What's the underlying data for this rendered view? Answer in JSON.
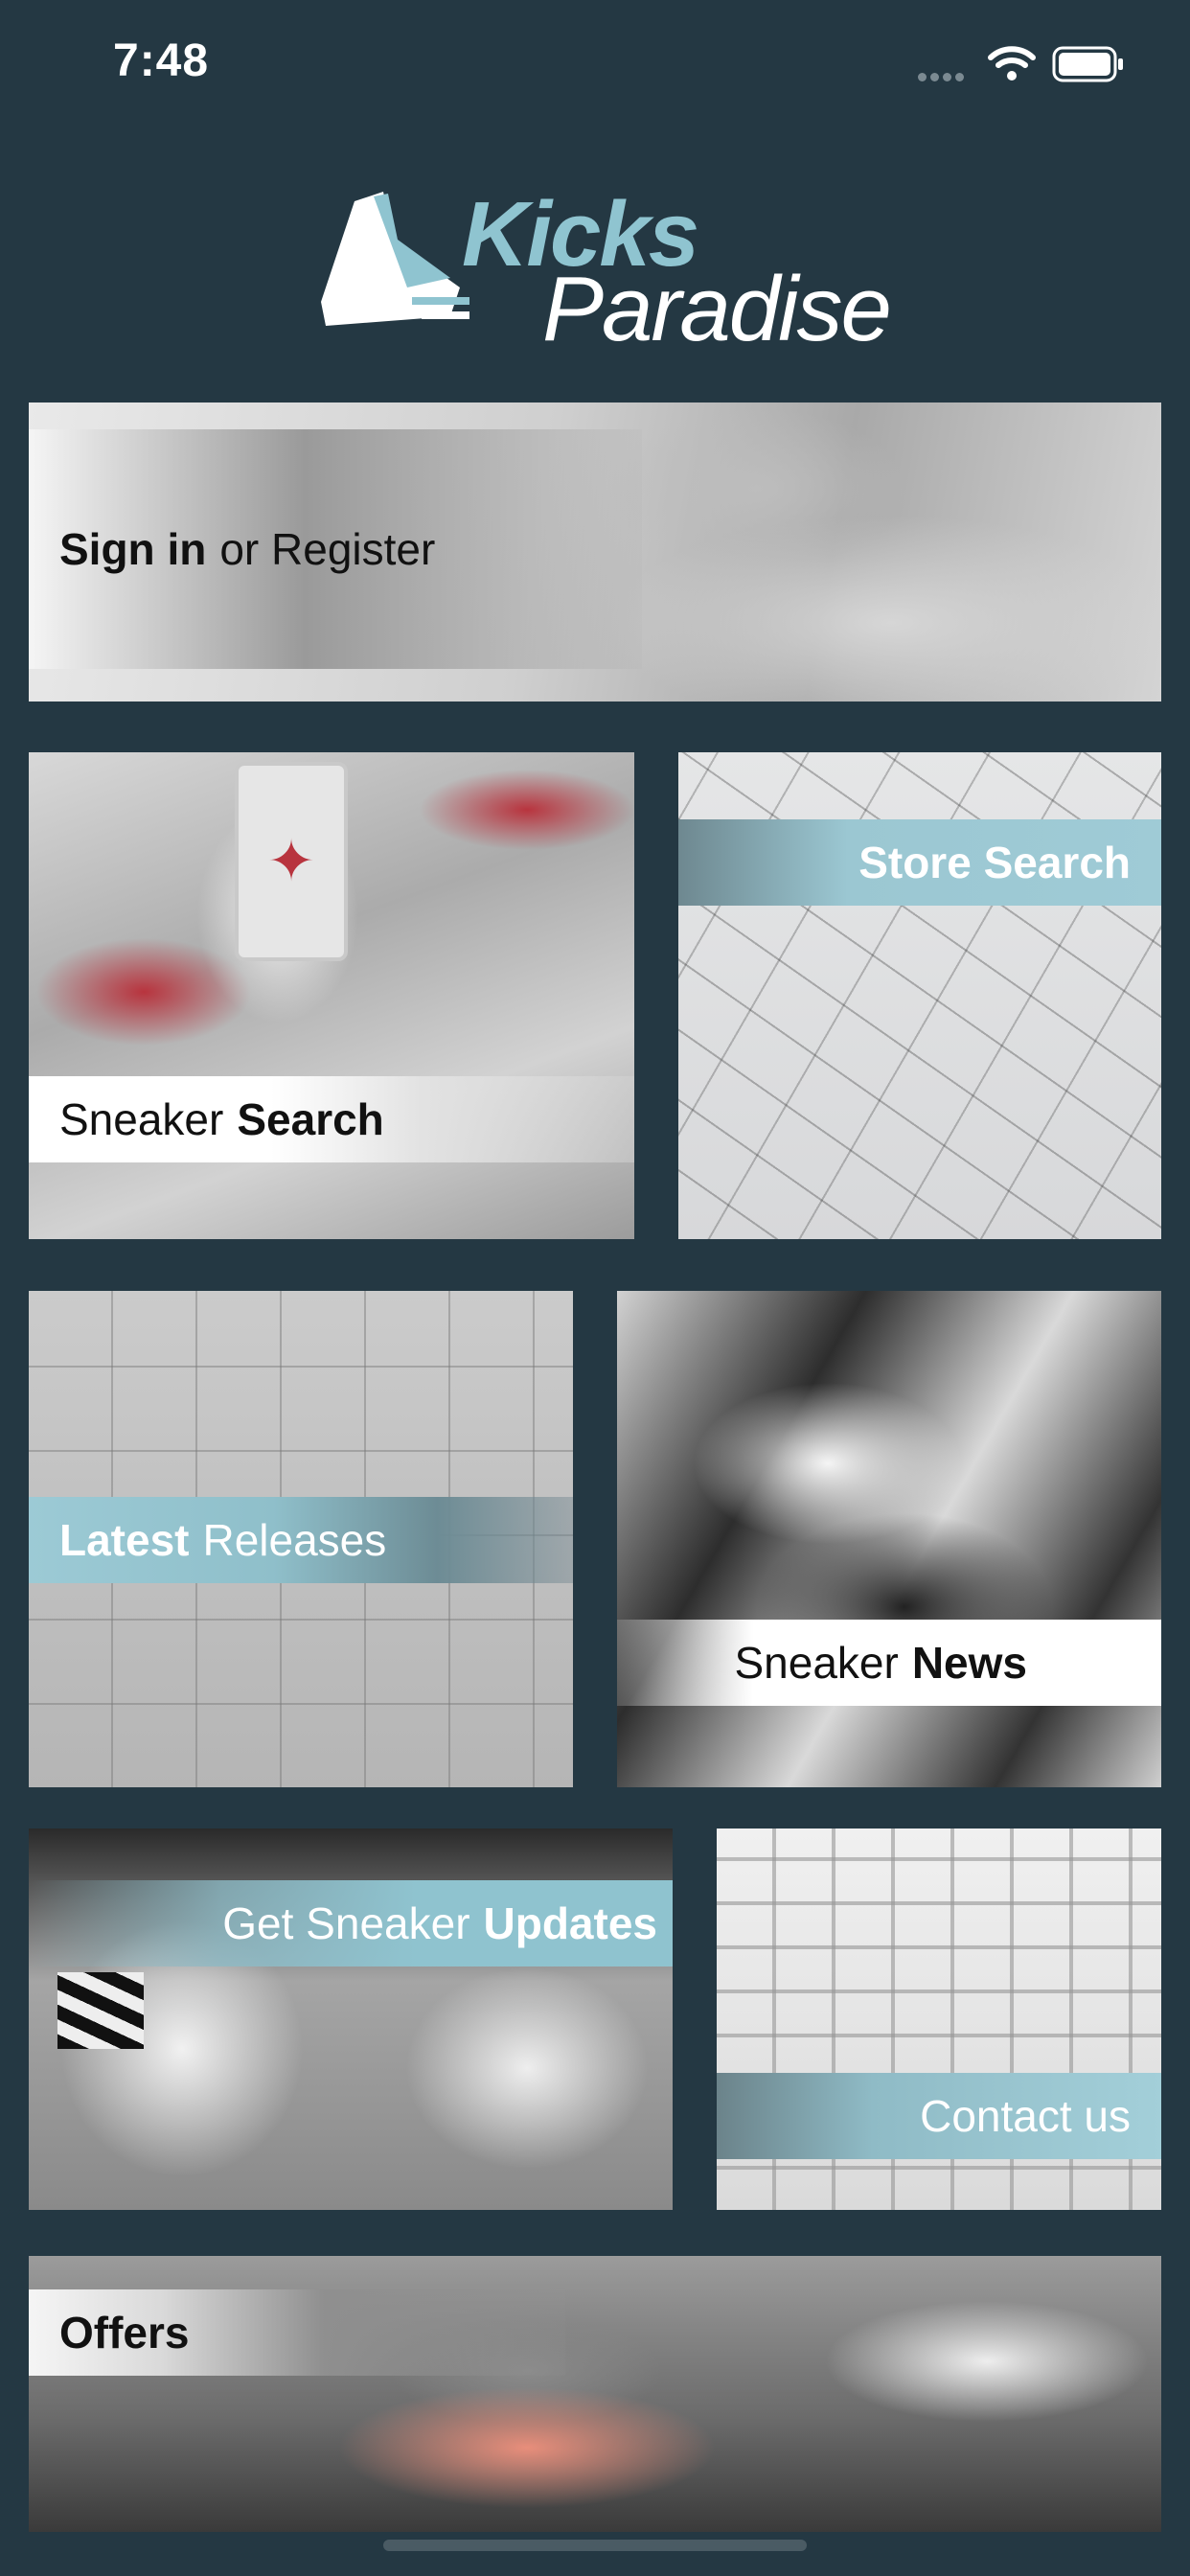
{
  "status_bar": {
    "time": "7:48",
    "icons": [
      "signal-icon",
      "wifi-icon",
      "battery-icon"
    ]
  },
  "logo": {
    "line1": "Kicks",
    "line2": "Paradise",
    "accent_color": "#8fc4d0"
  },
  "tiles": {
    "signin": {
      "bold": "Sign in",
      "regular": "or Register"
    },
    "sneaker_search": {
      "regular": "Sneaker",
      "bold": "Search"
    },
    "store_search": {
      "bold": "Store Search"
    },
    "latest_releases": {
      "bold": "Latest",
      "regular": "Releases"
    },
    "sneaker_news": {
      "regular": "Sneaker",
      "bold": "News"
    },
    "updates": {
      "regular": "Get Sneaker",
      "bold": "Updates"
    },
    "contact": {
      "regular": "Contact us"
    },
    "offers": {
      "bold": "Offers"
    }
  },
  "colors": {
    "background": "#243843",
    "accent": "#9ccad5"
  }
}
